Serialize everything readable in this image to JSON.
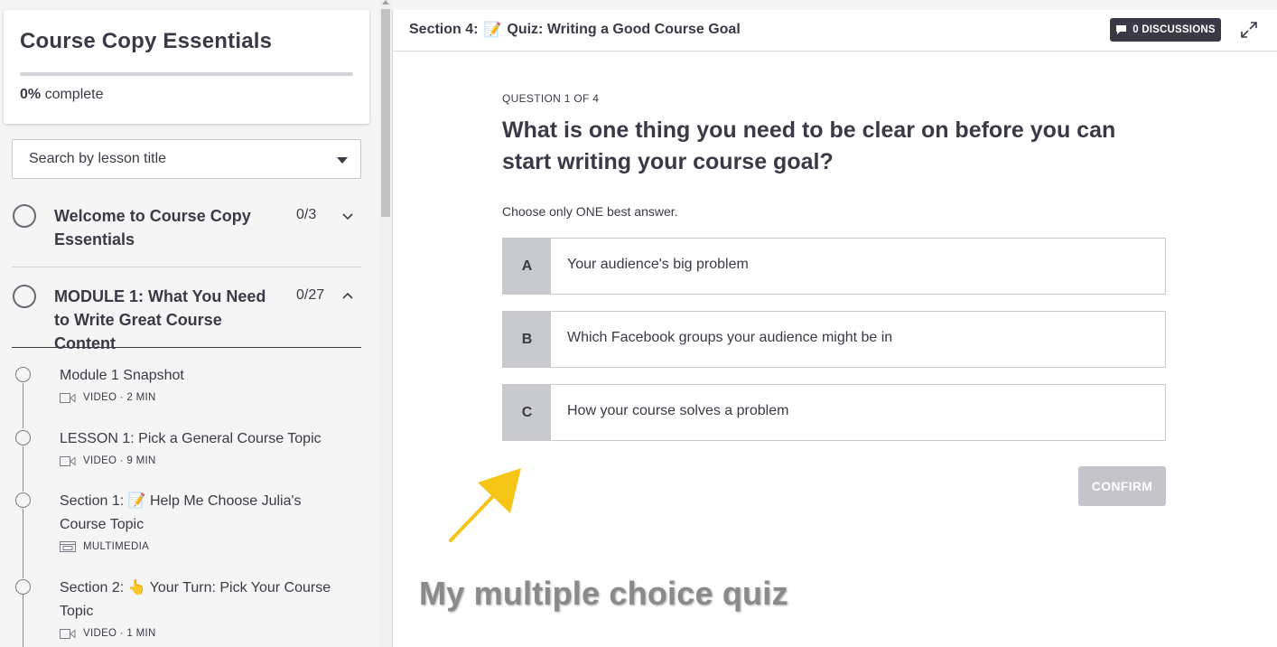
{
  "sidebar": {
    "course_title": "Course Copy Essentials",
    "progress_percent": 0,
    "progress_value": "0%",
    "progress_suffix": " complete",
    "search_placeholder": "Search by lesson title",
    "modules": [
      {
        "title": "Welcome to Course Copy Essentials",
        "count": "0/3",
        "expanded": false
      },
      {
        "title": "MODULE 1: What You Need to Write Great Course Content",
        "count": "0/27",
        "expanded": true
      }
    ],
    "lessons": [
      {
        "title": "Module 1 Snapshot",
        "meta": "VIDEO · 2 MIN",
        "icon": "video-icon"
      },
      {
        "title": "LESSON 1: Pick a General Course Topic",
        "meta": "VIDEO · 9 MIN",
        "icon": "video-icon"
      },
      {
        "title": "Section 1: 📝 Help Me Choose Julia's Course Topic",
        "meta": "MULTIMEDIA",
        "icon": "multimedia-icon"
      },
      {
        "title": "Section 2: 👆 Your Turn: Pick Your Course Topic",
        "meta": "VIDEO · 1 MIN",
        "icon": "video-icon"
      }
    ]
  },
  "header": {
    "section_label": "Section 4:",
    "section_emoji": "📝",
    "section_title": "Quiz: Writing a Good Course Goal",
    "discussions_label": "0 DISCUSSIONS"
  },
  "quiz": {
    "question_label": "QUESTION 1 OF 4",
    "question_text": "What is one thing you need to be clear on before you can start writing your course goal?",
    "instruction": "Choose only ONE best answer.",
    "choices": [
      {
        "letter": "A",
        "text": "Your audience's big problem"
      },
      {
        "letter": "B",
        "text": "Which Facebook groups your audience might be in"
      },
      {
        "letter": "C",
        "text": "How your course solves a problem"
      }
    ],
    "confirm_label": "CONFIRM"
  },
  "annotation": {
    "text": "My multiple choice quiz",
    "arrow_color": "#f5c518"
  },
  "colors": {
    "primary": "#3a3a46",
    "choice_letter_bg": "#c9c9d0",
    "confirm_disabled": "#c4c4ca"
  }
}
